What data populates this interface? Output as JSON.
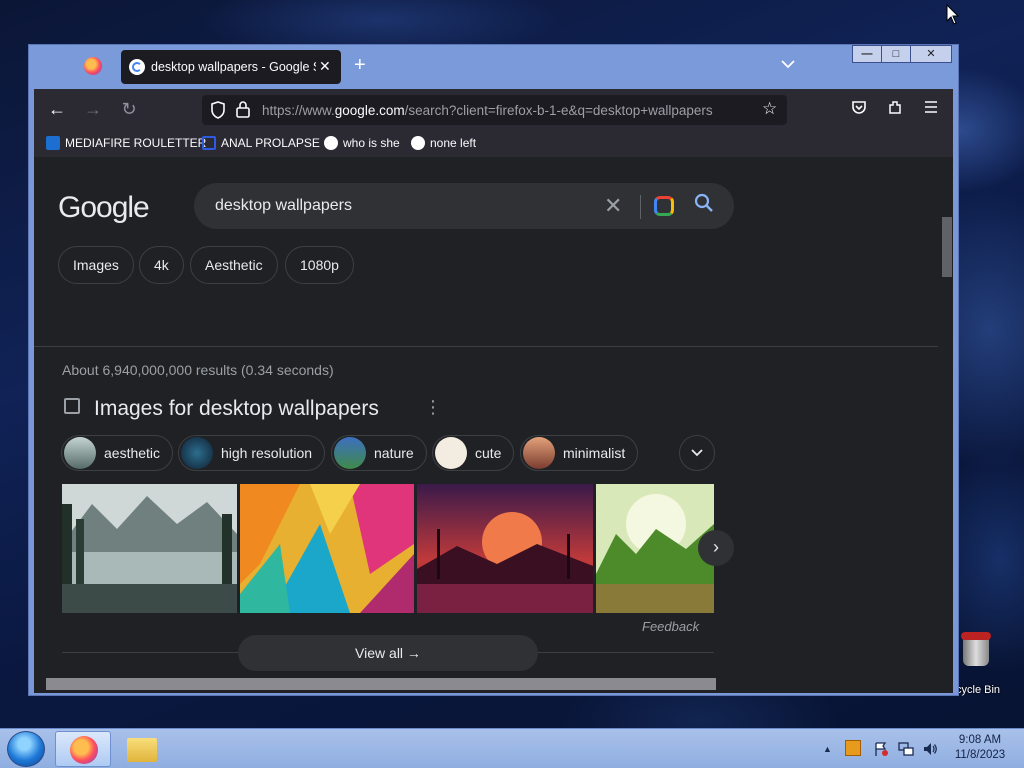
{
  "desktop": {
    "recycle_bin_label": "cycle Bin"
  },
  "browser": {
    "tab": {
      "title": "desktop wallpapers - Google Se",
      "close_glyph": "✕"
    },
    "new_tab_glyph": "+",
    "tab_list_glyph": "⌄",
    "window_controls": {
      "minimize": "—",
      "maximize": "□",
      "close": "✕"
    },
    "nav": {
      "back": "←",
      "forward": "→",
      "reload": "↻"
    },
    "url": {
      "prefix": "https://www.",
      "domain": "google.com",
      "path": "/search?client=firefox-b-1-e&q=desktop+wallpapers"
    },
    "toolbar": {
      "bookmark_star": "☆",
      "pocket": "◘",
      "extensions": "⧉",
      "menu": "≡"
    },
    "bookmarks": [
      {
        "label": "MEDIAFIRE ROULETTER",
        "icon": "mediafire-icon",
        "color": "#1c6fd1"
      },
      {
        "label": "ANAL PROLAPSE",
        "icon": "bookmark-blue-icon",
        "color": "#2d5be3"
      },
      {
        "label": "who is she",
        "icon": "google-icon",
        "color": "#ffffff"
      },
      {
        "label": "none left",
        "icon": "google-icon",
        "color": "#ffffff"
      }
    ]
  },
  "google": {
    "logo": "Google",
    "query": "desktop wallpapers",
    "clear_glyph": "✕",
    "search_glyph": "⌕",
    "chips": [
      "Images",
      "4k",
      "Aesthetic",
      "1080p"
    ],
    "stats": "About 6,940,000,000 results (0.34 seconds)",
    "images_header": "Images for desktop wallpapers",
    "more_glyph": "⋮",
    "subchips": [
      {
        "label": "aesthetic",
        "color": "#6f8c8a"
      },
      {
        "label": "high resolution",
        "color": "#1e3d5c"
      },
      {
        "label": "nature",
        "color": "#3f8a4a"
      },
      {
        "label": "cute",
        "color": "#f0e6d6"
      },
      {
        "label": "minimalist",
        "color": "#c8603c"
      }
    ],
    "expand_glyph": "⌄",
    "next_glyph": "›",
    "feedback": "Feedback",
    "view_all": "View all →"
  },
  "taskbar": {
    "tray_up": "▲",
    "time": "9:08 AM",
    "date": "11/8/2023"
  }
}
